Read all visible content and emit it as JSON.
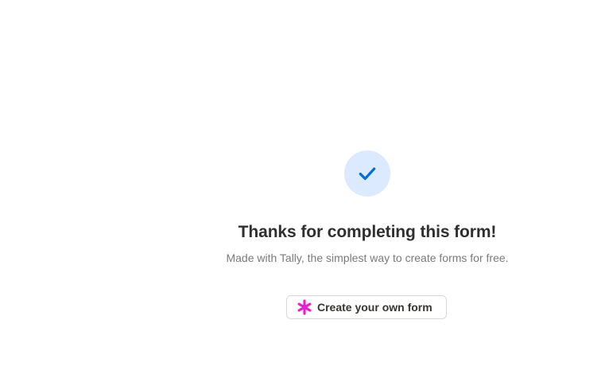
{
  "success": {
    "heading": "Thanks for completing this form!",
    "subtext": "Made with Tally, the simplest way to create forms for free."
  },
  "cta": {
    "label": "Create your own form"
  },
  "icons": {
    "success": "checkmark-icon",
    "cta": "tally-asterisk-icon"
  },
  "colors": {
    "check_circle_bg": "#dbeafe",
    "check_mark": "#0070d7",
    "asterisk": "#e91ed0",
    "heading": "#2f2f2f",
    "subtext": "#7a7a7a"
  }
}
